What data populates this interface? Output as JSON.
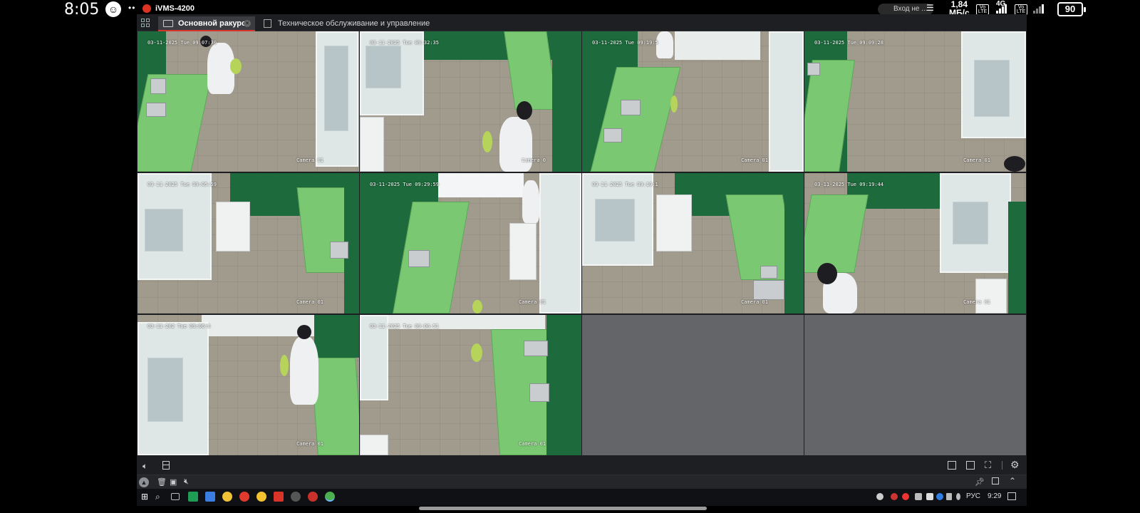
{
  "status_bar": {
    "clock": "8:05",
    "app_name": "iVMS-4200",
    "signin_label": "Вход не ...",
    "speed_value": "1,84",
    "speed_unit": "МБ/с",
    "lte_label_1": "Vo LTE",
    "network_type": "4G",
    "lte_label_2": "Vo LTE",
    "battery": "90"
  },
  "tabs": [
    {
      "label": "Основной ракурс",
      "active": true
    },
    {
      "label": "Техническое обслуживание и управление",
      "active": false
    }
  ],
  "cameras": [
    {
      "timestamp": "03-11-2025 Tue 09:07:30",
      "name": "Camera 01"
    },
    {
      "timestamp": "03-11-2025 Tue 09:32:35",
      "name": "Camera 0"
    },
    {
      "timestamp": "03-11-2025 Tue 09:19:5",
      "name": "Camera 01"
    },
    {
      "timestamp": "03-11-2025 Tue 09:09:28",
      "name": "Camera 01"
    },
    {
      "timestamp": "03-11-2025 Tue 09:05:59",
      "name": "Camera 01"
    },
    {
      "timestamp": "03-11-2025 Tue 09:29:59",
      "name": "Camera 01"
    },
    {
      "timestamp": "03-11-2025 Tue 09:10:1",
      "name": "Camera 01"
    },
    {
      "timestamp": "03-11-2025 Tue 09:19:44",
      "name": "Camera 01"
    },
    {
      "timestamp": "03-11-202 Tue 09:06:6",
      "name": "Camera 01"
    },
    {
      "timestamp": "03-11-2025 Tue 09:06:51",
      "name": "Camera 01"
    }
  ],
  "empty_cells": 2,
  "taskbar": {
    "language": "РУС",
    "time": "9:29"
  },
  "colors": {
    "accent": "#d9342b",
    "window_bg": "#1e1f22",
    "empty_cell": "#636568",
    "lab_green": "#1d6b3c",
    "bench_green": "#7bc873"
  }
}
